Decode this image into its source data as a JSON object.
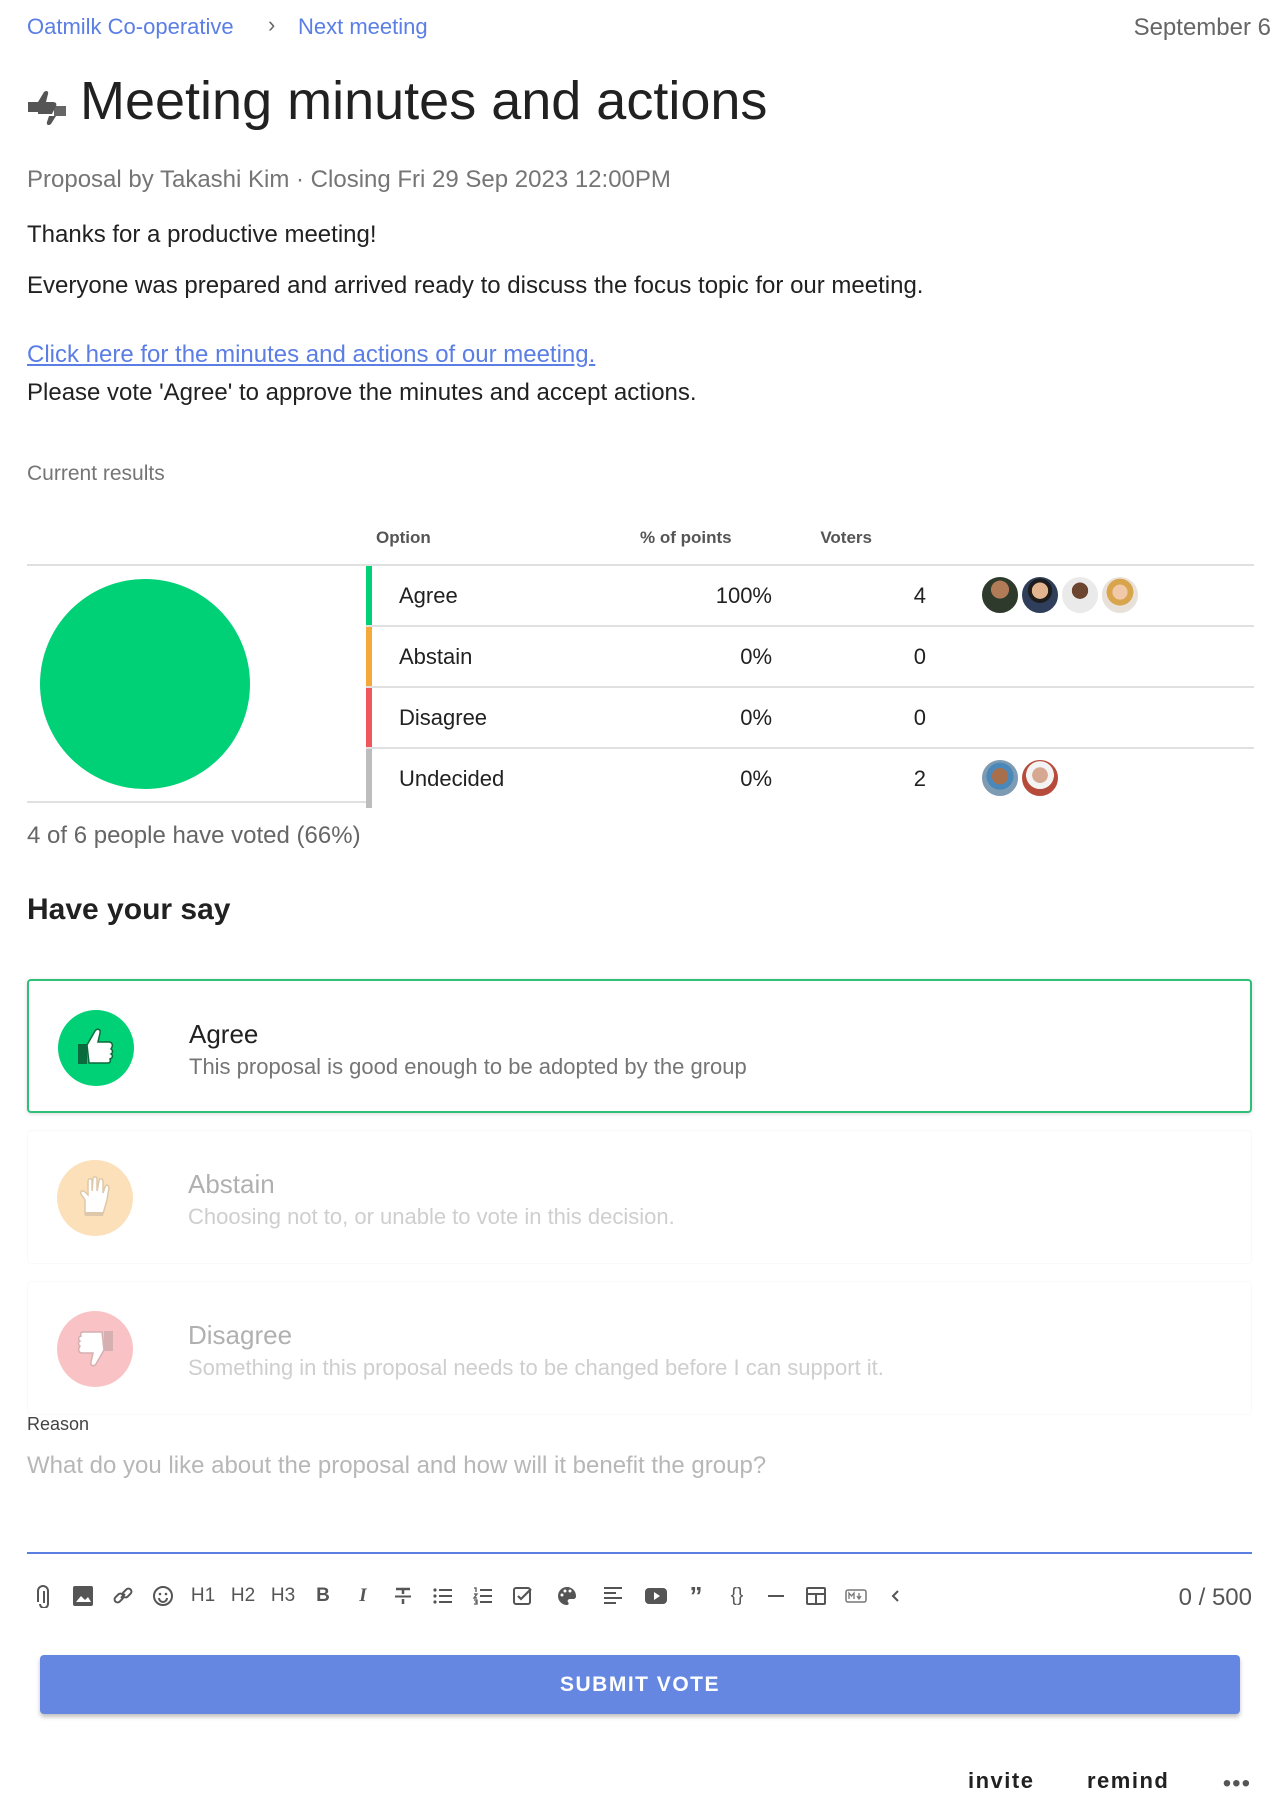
{
  "breadcrumb": {
    "group": "Oatmilk Co-operative",
    "separator": "›",
    "page": "Next meeting"
  },
  "header": {
    "date": "September 6"
  },
  "proposal": {
    "title": "Meeting minutes and actions",
    "meta": "Proposal by Takashi Kim · Closing Fri 29 Sep 2023 12:00PM",
    "body": [
      "Thanks for a productive meeting!",
      "Everyone was prepared and arrived ready to discuss the focus topic for our meeting."
    ],
    "link_text": "Click here for the minutes and actions of our meeting.",
    "call_to_action": "Please vote 'Agree' to approve the minutes and accept actions."
  },
  "results": {
    "label": "Current results",
    "columns": {
      "option": "Option",
      "points": "% of points",
      "voters": "Voters"
    },
    "rows": [
      {
        "option": "Agree",
        "percent": "100%",
        "voters": "4",
        "color": "#00d176",
        "avatar_count": 4
      },
      {
        "option": "Abstain",
        "percent": "0%",
        "voters": "0",
        "color": "#f6a93b",
        "avatar_count": 0
      },
      {
        "option": "Disagree",
        "percent": "0%",
        "voters": "0",
        "color": "#f0575d",
        "avatar_count": 0
      },
      {
        "option": "Undecided",
        "percent": "0%",
        "voters": "2",
        "color": "#bdbdbd",
        "avatar_count": 2
      }
    ],
    "pie_color": "#00d176",
    "voted_summary": "4 of 6 people have voted (66%)"
  },
  "vote": {
    "heading": "Have your say",
    "options": [
      {
        "name": "Agree",
        "description": "This proposal is good enough to be adopted by the group",
        "icon": "thumbs-up-icon",
        "color": "#00d176",
        "selected": true
      },
      {
        "name": "Abstain",
        "description": "Choosing not to, or unable to vote in this decision.",
        "icon": "hand-icon",
        "color": "#f6a93b",
        "selected": false
      },
      {
        "name": "Disagree",
        "description": "Something in this proposal needs to be changed before I can support it.",
        "icon": "thumbs-down-icon",
        "color": "#f0575d",
        "selected": false
      }
    ],
    "reason_label": "Reason",
    "reason_placeholder": "What do you like about the proposal and how will it benefit the group?",
    "char_count": "0 / 500",
    "submit_label": "SUBMIT VOTE"
  },
  "toolbar": {
    "h1": "H1",
    "h2": "H2",
    "h3": "H3",
    "bold": "B",
    "italic": "I",
    "code": "{}",
    "icons": [
      "paperclip-icon",
      "image-icon",
      "link-icon",
      "emoji-icon",
      "heading-1",
      "heading-2",
      "heading-3",
      "bold-icon",
      "italic-icon",
      "strikethrough-icon",
      "bullet-list-icon",
      "numbered-list-icon",
      "task-list-icon",
      "palette-icon",
      "align-icon",
      "video-icon",
      "quote-icon",
      "code-icon",
      "divider-icon",
      "table-icon",
      "markdown-icon",
      "collapse-icon"
    ]
  },
  "footer": {
    "invite": "invite",
    "remind": "remind",
    "more": "•••"
  }
}
